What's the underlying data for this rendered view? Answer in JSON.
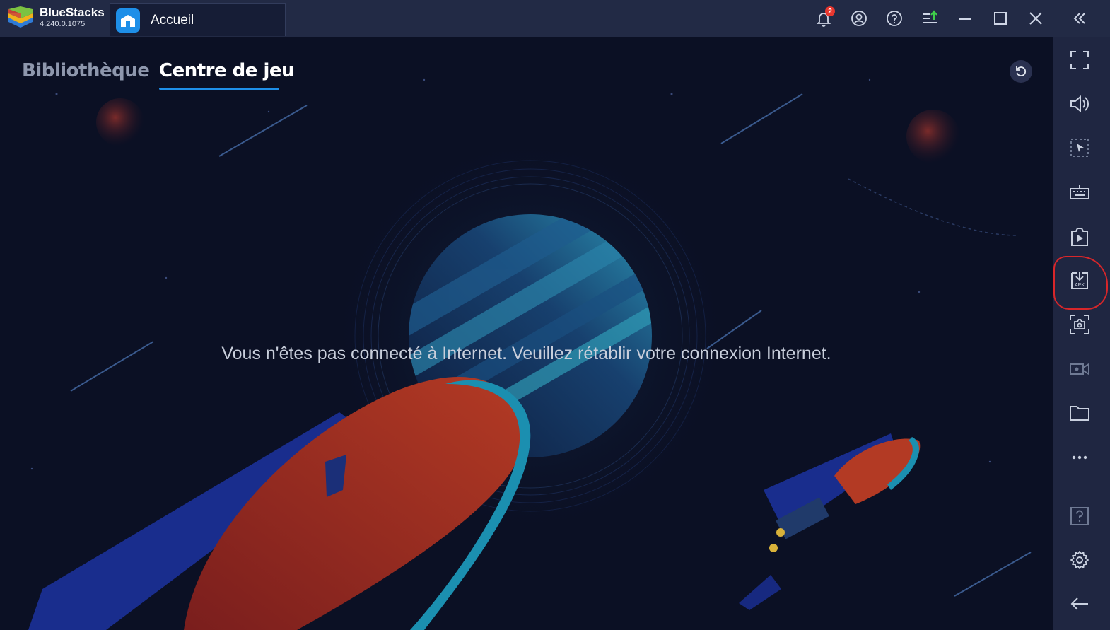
{
  "window": {
    "brand_name": "BlueStacks",
    "version": "4.240.0.1075",
    "tab_label": "Accueil",
    "notification_count": "2"
  },
  "main": {
    "tabs": [
      {
        "label": "Bibliothèque",
        "active": false
      },
      {
        "label": "Centre de jeu",
        "active": true
      }
    ],
    "offline_message": "Vous n'êtes pas connecté à Internet. Veuillez rétablir votre connexion Internet."
  },
  "colors": {
    "accent": "#1e8fe8",
    "background": "#0b1024",
    "titlebar": "#222a45",
    "sidebar": "#1f2641",
    "highlight": "#d8262a"
  },
  "titlebar_icons": [
    "notification-bell-icon",
    "account-icon",
    "help-icon",
    "update-icon",
    "minimize-icon",
    "maximize-icon",
    "close-icon",
    "collapse-sidebar-icon"
  ],
  "sidebar_icons": [
    "fullscreen-icon",
    "volume-icon",
    "pointer-icon",
    "keyboard-icon",
    "macro-icon",
    "install-apk-icon",
    "screenshot-icon",
    "record-icon",
    "folder-icon",
    "more-icon",
    "help-icon",
    "settings-icon",
    "back-icon"
  ],
  "apk_icon_text": "APK"
}
